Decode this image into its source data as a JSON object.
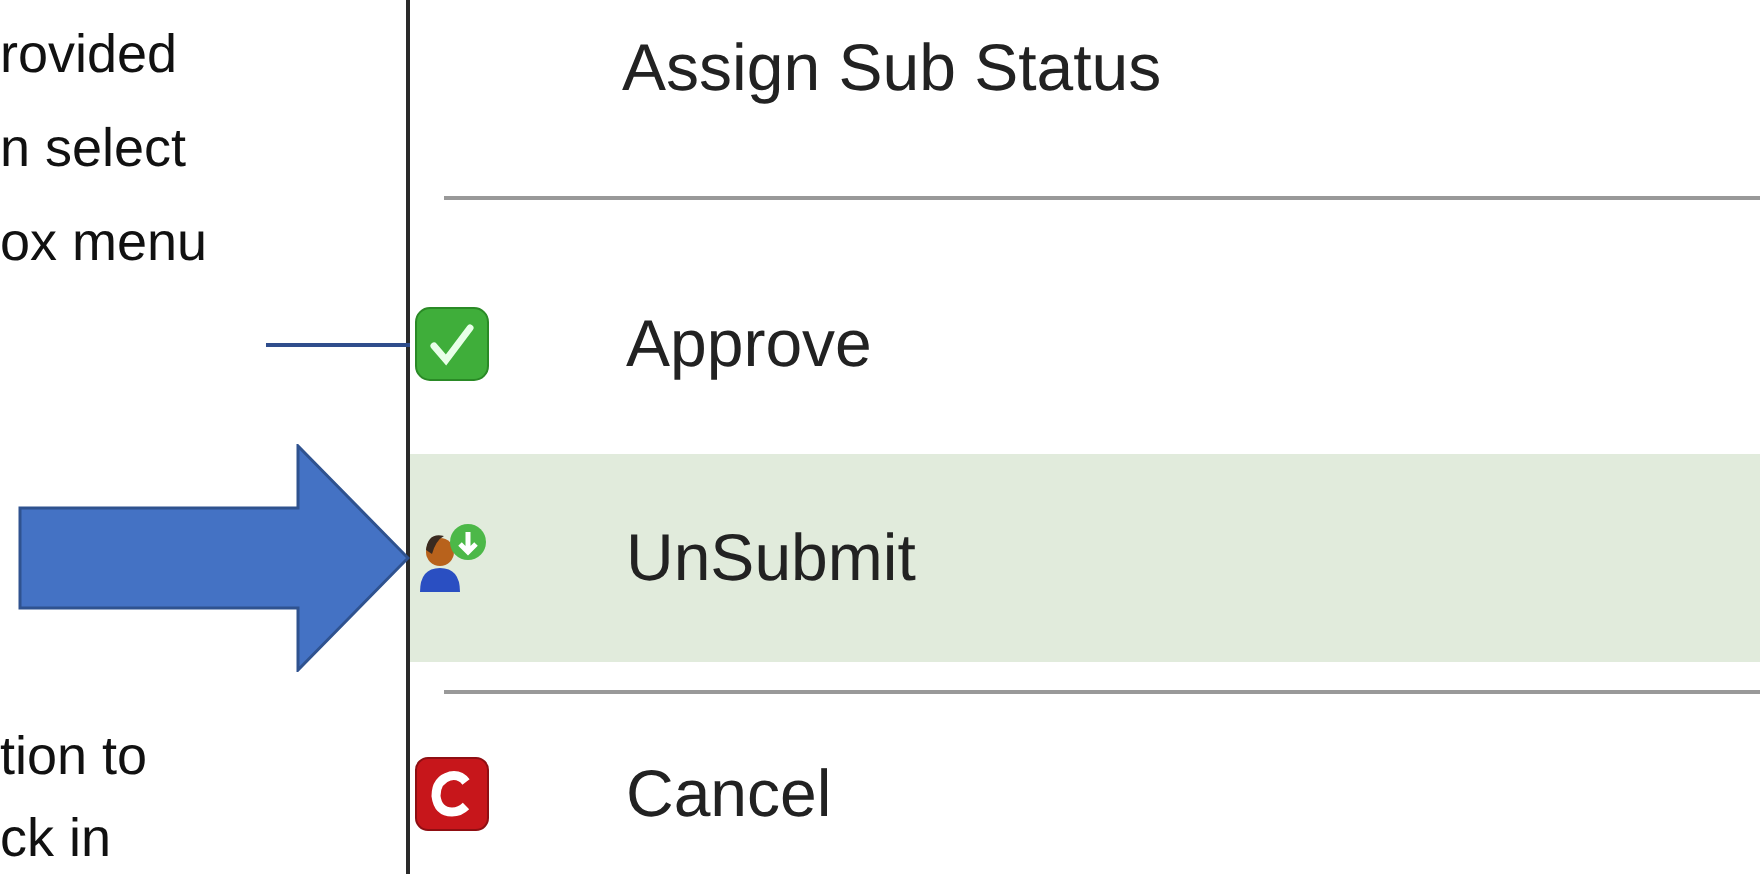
{
  "annotation": {
    "top_lines": [
      "rovided",
      "n select",
      "ox menu"
    ],
    "bottom_lines": [
      "tion to",
      "ck in"
    ]
  },
  "menu": {
    "title": "Assign Sub Status",
    "groups": [
      [
        {
          "label": "Approve",
          "kind": "approve",
          "selected": false
        },
        {
          "label": "UnSubmit",
          "kind": "unsubmit",
          "selected": true
        }
      ],
      [
        {
          "label": "Cancel",
          "kind": "cancel",
          "selected": false
        }
      ]
    ]
  }
}
